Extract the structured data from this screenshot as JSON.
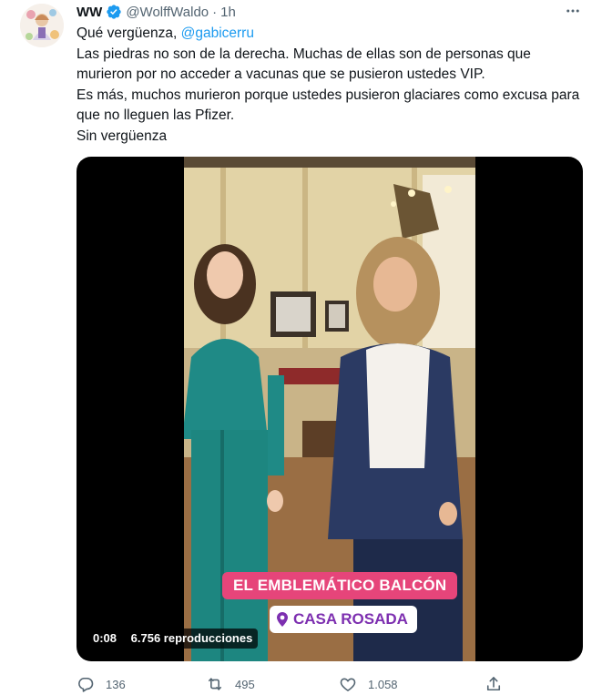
{
  "tweet": {
    "author_name": "WW",
    "handle": "@WolffWaldo",
    "separator": "·",
    "time": "1h",
    "line1_prefix": "Qué vergüenza, ",
    "line1_mention": "@gabicerru",
    "line2": "Las piedras no son de la derecha. Muchas de ellas son de personas que murieron por no acceder a vacunas que se pusieron ustedes VIP.",
    "line3": "Es más, muchos murieron porque ustedes pusieron glaciares como excusa para que no lleguen las Pfizer.",
    "line4": "Sin vergüenza"
  },
  "video": {
    "caption_top": "EL EMBLEMÁTICO BALCÓN",
    "caption_location": "CASA ROSADA",
    "duration": "0:08",
    "views": "6.756 reproducciones"
  },
  "actions": {
    "replies": "136",
    "retweets": "495",
    "likes": "1.058"
  },
  "colors": {
    "accent": "#1d9bf0",
    "muted": "#536471",
    "caption_pink": "#e6457a",
    "caption_purple": "#7d2fb0"
  },
  "icons": [
    "verified-badge-icon",
    "more-icon",
    "reply-icon",
    "retweet-icon",
    "like-icon",
    "share-icon",
    "location-pin-icon"
  ]
}
